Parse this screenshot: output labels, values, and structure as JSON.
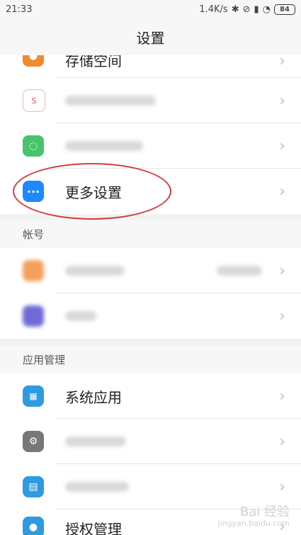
{
  "status_bar": {
    "time": "21:33",
    "network_speed": "1.4K/s",
    "battery": "84"
  },
  "title": "设置",
  "group1": {
    "rows": [
      {
        "label": "存储空间",
        "icon": "storage-icon",
        "icon_color": "#f08a2c"
      },
      {
        "label": "",
        "icon": "s-logo-icon",
        "icon_color": "#ffffff"
      },
      {
        "label": "",
        "icon": "stopwatch-icon",
        "icon_color": "#47c46b"
      },
      {
        "label": "更多设置",
        "icon": "more-icon",
        "icon_color": "#1e88ff"
      }
    ]
  },
  "account_section": {
    "header": "帐号",
    "rows": [
      {
        "label": "",
        "icon": "account-avatar-icon",
        "icon_color": "#f4a05b"
      },
      {
        "label": "",
        "icon": "purple-account-icon",
        "icon_color": "#6f6ad6"
      }
    ]
  },
  "app_section": {
    "header": "应用管理",
    "rows": [
      {
        "label": "系统应用",
        "icon": "apps-icon",
        "icon_color": "#2e9be0"
      },
      {
        "label": "",
        "icon": "settings-icon",
        "icon_color": "#777777"
      },
      {
        "label": "",
        "icon": "document-icon",
        "icon_color": "#2e9be0"
      },
      {
        "label": "授权管理",
        "icon": "shield-icon",
        "icon_color": "#2e9be0"
      }
    ]
  },
  "watermark": {
    "main": "Bai 经验",
    "sub": "jingyan.baidu.com"
  }
}
